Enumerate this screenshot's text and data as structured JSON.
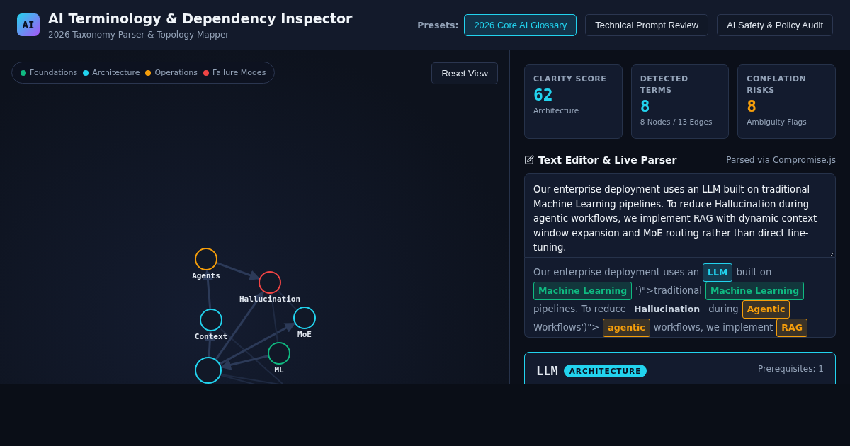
{
  "header": {
    "logo": "AI",
    "title": "AI Terminology & Dependency Inspector",
    "subtitle": "2026 Taxonomy Parser & Topology Mapper",
    "presets_label": "Presets:",
    "presets": [
      {
        "label": "2026 Core AI Glossary",
        "selected": true
      },
      {
        "label": "Technical Prompt Review",
        "selected": false
      },
      {
        "label": "AI Safety & Policy Audit",
        "selected": false
      }
    ]
  },
  "graph": {
    "legend": [
      {
        "label": "Foundations",
        "color": "#10b981"
      },
      {
        "label": "Architecture",
        "color": "#22d3ee"
      },
      {
        "label": "Operations",
        "color": "#f59e0b"
      },
      {
        "label": "Failure Modes",
        "color": "#ef4444"
      }
    ],
    "reset_button": "Reset View",
    "nodes": [
      {
        "label": "Agents",
        "color": "#f59e0b"
      },
      {
        "label": "Hallucination",
        "color": "#ef4444"
      },
      {
        "label": "Context",
        "color": "#22d3ee"
      },
      {
        "label": "MoE",
        "color": "#22d3ee"
      },
      {
        "label": "ML",
        "color": "#10b981"
      },
      {
        "color": "#22d3ee"
      }
    ]
  },
  "stats": [
    {
      "label": "CLARITY SCORE",
      "value": "62",
      "sub": "Architecture",
      "color": "#22d3ee"
    },
    {
      "label": "DETECTED TERMS",
      "value": "8",
      "sub": "8 Nodes / 13 Edges",
      "color": "#22d3ee"
    },
    {
      "label": "CONFLATION RISKS",
      "value": "8",
      "sub": "Ambiguity Flags",
      "color": "#f59e0b"
    }
  ],
  "editor": {
    "title": "Text Editor & Live Parser",
    "parser_note": "Parsed via Compromise.js",
    "text": "Our enterprise deployment uses an LLM built on traditional Machine Learning pipelines. To reduce Hallucination during agentic workflows, we implement RAG with dynamic context window expansion and MoE routing rather than direct fine-tuning.",
    "parsed": [
      {
        "kind": "text",
        "text": "Our enterprise deployment uses an"
      },
      {
        "kind": "tag",
        "text": "LLM",
        "color": "#22d3ee"
      },
      {
        "kind": "text",
        "text": "built on"
      },
      {
        "kind": "tag",
        "text": "Machine Learning",
        "color": "#10b981"
      },
      {
        "kind": "text",
        "text": "')\">traditional"
      },
      {
        "kind": "tag",
        "text": "Machine Learning",
        "color": "#10b981"
      },
      {
        "kind": "text",
        "text": "pipelines. To reduce"
      },
      {
        "kind": "term",
        "text": "Hallucination"
      },
      {
        "kind": "text",
        "text": "during"
      },
      {
        "kind": "tag",
        "text": "Agentic",
        "color": "#f59e0b"
      },
      {
        "kind": "text",
        "text": "Workflows')\">"
      },
      {
        "kind": "tag",
        "text": "agentic",
        "color": "#f59e0b"
      },
      {
        "kind": "text",
        "text": "workflows, we implement"
      },
      {
        "kind": "tag",
        "text": "RAG",
        "color": "#f59e0b"
      }
    ]
  },
  "detail": {
    "term": "LLM",
    "category": "ARCHITECTURE",
    "color": "#22d3ee",
    "prerequisites": "Prerequisites: 1"
  }
}
